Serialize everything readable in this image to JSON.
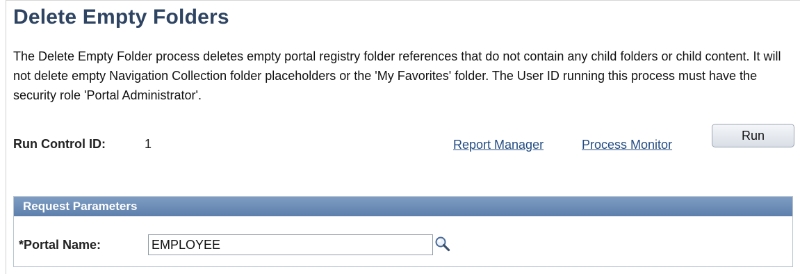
{
  "page": {
    "title": "Delete Empty Folders",
    "description": "The Delete Empty Folder process deletes empty portal registry folder references that do not contain any child folders or child content. It will not delete empty Navigation Collection folder placeholders or the 'My Favorites' folder. The User ID running this process must have the security role 'Portal Administrator'."
  },
  "run_control": {
    "label": "Run Control ID:",
    "value": "1"
  },
  "links": {
    "report_manager": "Report Manager",
    "process_monitor": "Process Monitor"
  },
  "buttons": {
    "run": "Run"
  },
  "request_parameters": {
    "header": "Request Parameters",
    "portal_name_label": "*Portal Name:",
    "portal_name_value": "EMPLOYEE",
    "lookup_icon": "magnifier-lookup-icon"
  },
  "colors": {
    "title": "#2e4462",
    "link": "#234c82",
    "panel_header": "#6b8cb8"
  }
}
